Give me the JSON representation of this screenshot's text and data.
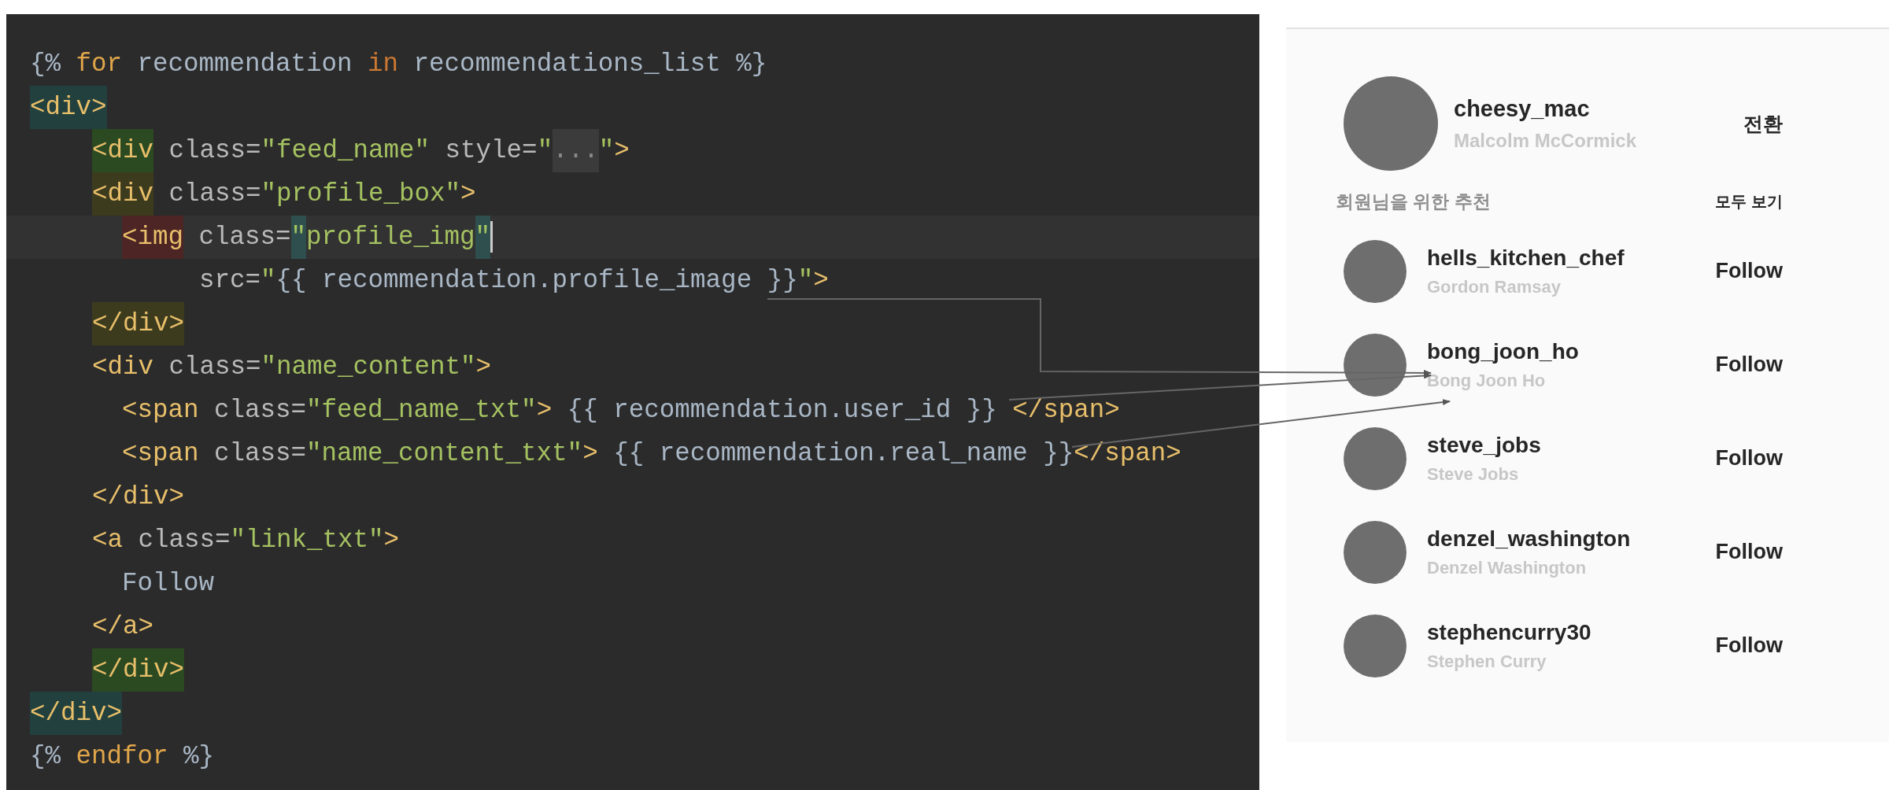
{
  "code": {
    "lines": [
      {
        "current": false,
        "tokens": [
          {
            "text": "{% ",
            "kind": "tpl"
          },
          {
            "text": "for",
            "kind": "kw"
          },
          {
            "text": " recommendation ",
            "kind": "tpl"
          },
          {
            "text": "in",
            "kind": "kw2"
          },
          {
            "text": " recommendations_list %}",
            "kind": "tpl"
          }
        ]
      },
      {
        "current": false,
        "tokens": [
          {
            "text": "<div>",
            "kind": "tag",
            "color": "#22403e"
          }
        ],
        "children": [
          {
            "current": false,
            "tokens": [
              {
                "text": "<div",
                "kind": "tag",
                "color": "#2b4a22"
              },
              {
                "text": " class=",
                "kind": "attr"
              },
              {
                "text": "\"feed_name\"",
                "kind": "str"
              },
              {
                "text": " style=",
                "kind": "attr"
              },
              {
                "text": "\"",
                "kind": "str"
              },
              {
                "text": "...",
                "kind": "fold",
                "color": "#3b3b3b"
              },
              {
                "text": "\"",
                "kind": "str"
              },
              {
                "text": ">",
                "kind": "tag"
              }
            ]
          },
          {
            "current": false,
            "tokens": [
              {
                "text": "<div",
                "kind": "tag",
                "color": "#3d3b1e"
              },
              {
                "text": " class=",
                "kind": "attr"
              },
              {
                "text": "\"profile_box\"",
                "kind": "str"
              },
              {
                "text": ">",
                "kind": "tag"
              }
            ],
            "children": [
              {
                "current": true,
                "tokens": [
                  {
                    "text": "<img",
                    "kind": "tag",
                    "color": "#4d2525"
                  },
                  {
                    "text": " class=",
                    "kind": "attr"
                  },
                  {
                    "text": "\"",
                    "kind": "str",
                    "color": "#2e4f4d"
                  },
                  {
                    "text": "profile_img",
                    "kind": "str"
                  },
                  {
                    "text": "\"",
                    "kind": "str",
                    "color": "#2e4f4d"
                  }
                ],
                "children": [
                  {
                    "current": false,
                    "tokens": [
                      {
                        "text": "src=",
                        "kind": "attr"
                      },
                      {
                        "text": "\"",
                        "kind": "str"
                      },
                      {
                        "text": "{{ recommendation.profile_image }}",
                        "kind": "tpl"
                      },
                      {
                        "text": "\"",
                        "kind": "str"
                      },
                      {
                        "text": ">",
                        "kind": "tag"
                      }
                    ]
                  }
                ]
              }
            ]
          },
          {
            "current": false,
            "tokens": [
              {
                "text": "</div>",
                "kind": "tag",
                "color": "#3d3b1e"
              }
            ]
          },
          {
            "current": false,
            "tokens": [
              {
                "text": "<div",
                "kind": "tag"
              },
              {
                "text": " class=",
                "kind": "attr"
              },
              {
                "text": "\"name_content\"",
                "kind": "str"
              },
              {
                "text": ">",
                "kind": "tag"
              }
            ],
            "children": [
              {
                "current": false,
                "tokens": [
                  {
                    "text": "<span",
                    "kind": "tag"
                  },
                  {
                    "text": " class=",
                    "kind": "attr"
                  },
                  {
                    "text": "\"feed_name_txt\"",
                    "kind": "str"
                  },
                  {
                    "text": ">",
                    "kind": "tag"
                  },
                  {
                    "text": " {{ recommendation.user_id }} ",
                    "kind": "tpl"
                  },
                  {
                    "text": "</span>",
                    "kind": "tag"
                  }
                ]
              },
              {
                "current": false,
                "tokens": [
                  {
                    "text": "<span",
                    "kind": "tag"
                  },
                  {
                    "text": " class=",
                    "kind": "attr"
                  },
                  {
                    "text": "\"name_content_txt\"",
                    "kind": "str"
                  },
                  {
                    "text": ">",
                    "kind": "tag"
                  },
                  {
                    "text": " {{ recommendation.real_name }}",
                    "kind": "tpl"
                  },
                  {
                    "text": "</span>",
                    "kind": "tag"
                  }
                ]
              }
            ]
          },
          {
            "current": false,
            "tokens": [
              {
                "text": "</div>",
                "kind": "tag"
              }
            ]
          },
          {
            "current": false,
            "tokens": [
              {
                "text": "<a",
                "kind": "tag"
              },
              {
                "text": " class=",
                "kind": "attr"
              },
              {
                "text": "\"link_txt\"",
                "kind": "str"
              },
              {
                "text": ">",
                "kind": "tag"
              }
            ],
            "children": [
              {
                "current": false,
                "tokens": [
                  {
                    "text": "Follow",
                    "kind": "tpl"
                  }
                ]
              }
            ]
          },
          {
            "current": false,
            "tokens": [
              {
                "text": "</a>",
                "kind": "tag"
              }
            ]
          },
          {
            "current": false,
            "tokens": [
              {
                "text": "</div>",
                "kind": "tag",
                "color": "#2b4a22"
              }
            ]
          }
        ]
      },
      {
        "current": false,
        "tokens": [
          {
            "text": "</div>",
            "kind": "tag",
            "color": "#22403e"
          }
        ]
      },
      {
        "current": false,
        "tokens": [
          {
            "text": "{% ",
            "kind": "tpl"
          },
          {
            "text": "endfor",
            "kind": "kw"
          },
          {
            "text": " %}",
            "kind": "tpl"
          }
        ]
      }
    ]
  },
  "profile": {
    "username": "cheesy_mac",
    "real_name": "Malcolm McCormick",
    "action": "전환"
  },
  "suggestions": {
    "title": "회원님을 위한 추천",
    "see_all": "모두 보기",
    "items": [
      {
        "username": "hells_kitchen_chef",
        "real_name": "Gordon Ramsay",
        "action": "Follow"
      },
      {
        "username": "bong_joon_ho",
        "real_name": "Bong Joon Ho",
        "action": "Follow"
      },
      {
        "username": "steve_jobs",
        "real_name": "Steve Jobs",
        "action": "Follow"
      },
      {
        "username": "denzel_washington",
        "real_name": "Denzel Washington",
        "action": "Follow"
      },
      {
        "username": "stephencurry30",
        "real_name": "Stephen Curry",
        "action": "Follow"
      }
    ]
  }
}
